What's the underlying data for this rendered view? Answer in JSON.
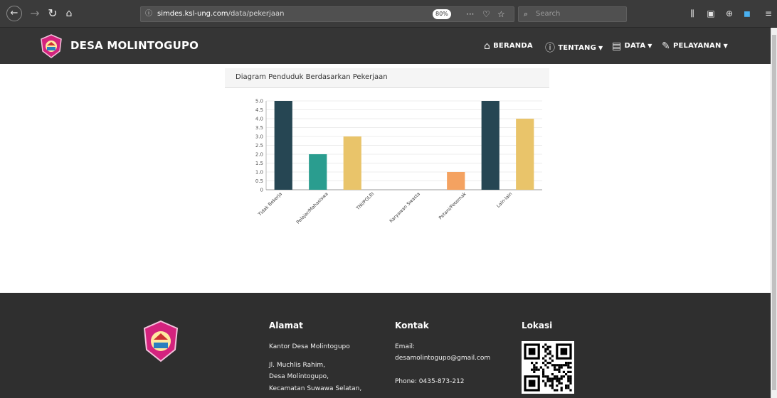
{
  "browser": {
    "url_domain": "simdes.ksl-ung.com",
    "url_path": "/data/pekerjaan",
    "zoom": "80%",
    "search_placeholder": "Search"
  },
  "header": {
    "brand": "DESA MOLINTOGUPO",
    "nav": [
      "BERANDA",
      "TENTANG",
      "DATA",
      "PELAYANAN"
    ]
  },
  "panel_title": "Diagram Penduduk Berdasarkan Pekerjaan",
  "chart_data": {
    "type": "bar",
    "categories": [
      "Tidak Bekerja",
      "Pelajar/Mahasiswa",
      "TNI/POLRI",
      "Karyawan Swasta",
      "Petani/Peternak",
      "Lain-lain"
    ],
    "values": [
      5,
      2,
      3,
      0,
      0,
      1,
      5,
      4
    ],
    "bars": [
      {
        "value": 5,
        "color": "#264653"
      },
      {
        "value": 2,
        "color": "#2a9d8f"
      },
      {
        "value": 3,
        "color": "#e9c46a"
      },
      {
        "value": 0,
        "color": "#264653"
      },
      {
        "value": 0,
        "color": "#2a9d8f"
      },
      {
        "value": 1,
        "color": "#f4a261"
      },
      {
        "value": 5,
        "color": "#264653"
      },
      {
        "value": 4,
        "color": "#e9c46a"
      }
    ],
    "ylim": [
      0,
      5
    ],
    "yticks": [
      "0",
      "0.5",
      "1.0",
      "1.5",
      "2.0",
      "2.5",
      "3.0",
      "3.5",
      "4.0",
      "4.5",
      "5.0"
    ],
    "grid": true
  },
  "footer": {
    "alamat_title": "Alamat",
    "alamat_line1": "Kantor Desa Molintogupo",
    "alamat_line2": "Jl. Muchlis Rahim,",
    "alamat_line3": "Desa Molintogupo,",
    "alamat_line4": "Kecamatan Suwawa Selatan,",
    "kontak_title": "Kontak",
    "email_label": "Email:",
    "email": "desamolintogupo@gmail.com",
    "phone": "Phone: 0435-873-212",
    "lokasi_title": "Lokasi"
  },
  "colors": {
    "header_bg": "#353535",
    "footer_bg": "#2f2f2f",
    "bar_dark": "#264653",
    "bar_teal": "#2a9d8f",
    "bar_yellow": "#e9c46a",
    "bar_orange": "#f4a261"
  }
}
